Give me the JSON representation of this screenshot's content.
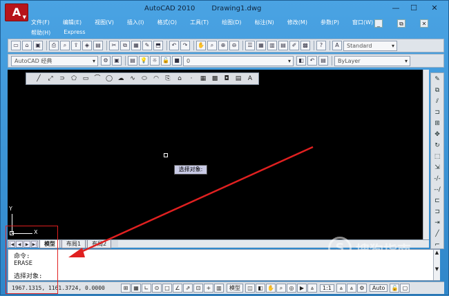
{
  "window": {
    "app_title": "AutoCAD 2010",
    "doc_title": "Drawing1.dwg",
    "logo_letter": "A"
  },
  "window_controls": {
    "min": "—",
    "max": "☐",
    "close": "✕"
  },
  "menu_row1": [
    "文件(F)",
    "编辑(E)",
    "视图(V)",
    "插入(I)",
    "格式(O)",
    "工具(T)",
    "绘图(D)",
    "标注(N)",
    "修改(M)",
    "参数(P)",
    "窗口(W)"
  ],
  "menu_row2": [
    "帮助(H)",
    "Express"
  ],
  "mdi_controls": [
    "_",
    "⧉",
    "✕"
  ],
  "toolbar1": {
    "style_combo": "Standard"
  },
  "toolbar2": {
    "workspace_combo": "AutoCAD 经典",
    "layer_combo": "0",
    "color_combo": "ByLayer"
  },
  "draw_toolbar_icons": [
    "line-icon",
    "construction-line-icon",
    "polyline-icon",
    "polygon-icon",
    "rectangle-icon",
    "arc-icon",
    "circle-icon",
    "revision-cloud-icon",
    "spline-icon",
    "ellipse-icon",
    "ellipse-arc-icon",
    "insert-block-icon",
    "make-block-icon",
    "point-icon",
    "hatch-icon",
    "gradient-icon",
    "region-icon",
    "table-icon",
    "mtext-icon"
  ],
  "draw_toolbar_glyphs": [
    "╱",
    "⤢",
    "⊃",
    "⬠",
    "▭",
    "⌒",
    "◯",
    "☁",
    "∿",
    "⬭",
    "◠",
    "⎘",
    "⌂",
    "·",
    "▦",
    "▩",
    "◘",
    "▤",
    "A"
  ],
  "tooltip": {
    "text": "选择对象:"
  },
  "ucs": {
    "y_label": "Y",
    "x_label": "X"
  },
  "layout_tabs": {
    "model": "模型",
    "layout1": "布局1",
    "layout2": "布局2"
  },
  "command": {
    "line1": "命令:",
    "line2": "ERASE",
    "line3": "选择对象:"
  },
  "status": {
    "coords": "1967.1315,  1161.3724,  0.0000",
    "model_label": "模型",
    "scale": "1:1",
    "workspace": "Auto"
  },
  "right_toolbar_icons": [
    "erase-icon",
    "copy-icon",
    "mirror-icon",
    "offset-icon",
    "array-icon",
    "move-icon",
    "rotate-icon",
    "scale-icon",
    "stretch-icon",
    "trim-icon",
    "extend-icon",
    "break-point-icon",
    "break-icon",
    "join-icon",
    "chamfer-icon",
    "fillet-icon",
    "explode-icon"
  ],
  "right_toolbar_glyphs": [
    "✎",
    "⧉",
    "⫽",
    "⊐",
    "⊞",
    "✥",
    "↻",
    "⬚",
    "⇲",
    "-/-",
    "--/",
    "⊏",
    "⊐",
    "⇥",
    "╱",
    "⌐",
    "✳"
  ],
  "watermark": {
    "brand": "搜狗指南",
    "url": "zhinan.sogou.com",
    "mark": "S"
  },
  "colors": {
    "arrow": "#e02020",
    "canvas": "#000000",
    "titlebar": "#3a8fd0"
  }
}
